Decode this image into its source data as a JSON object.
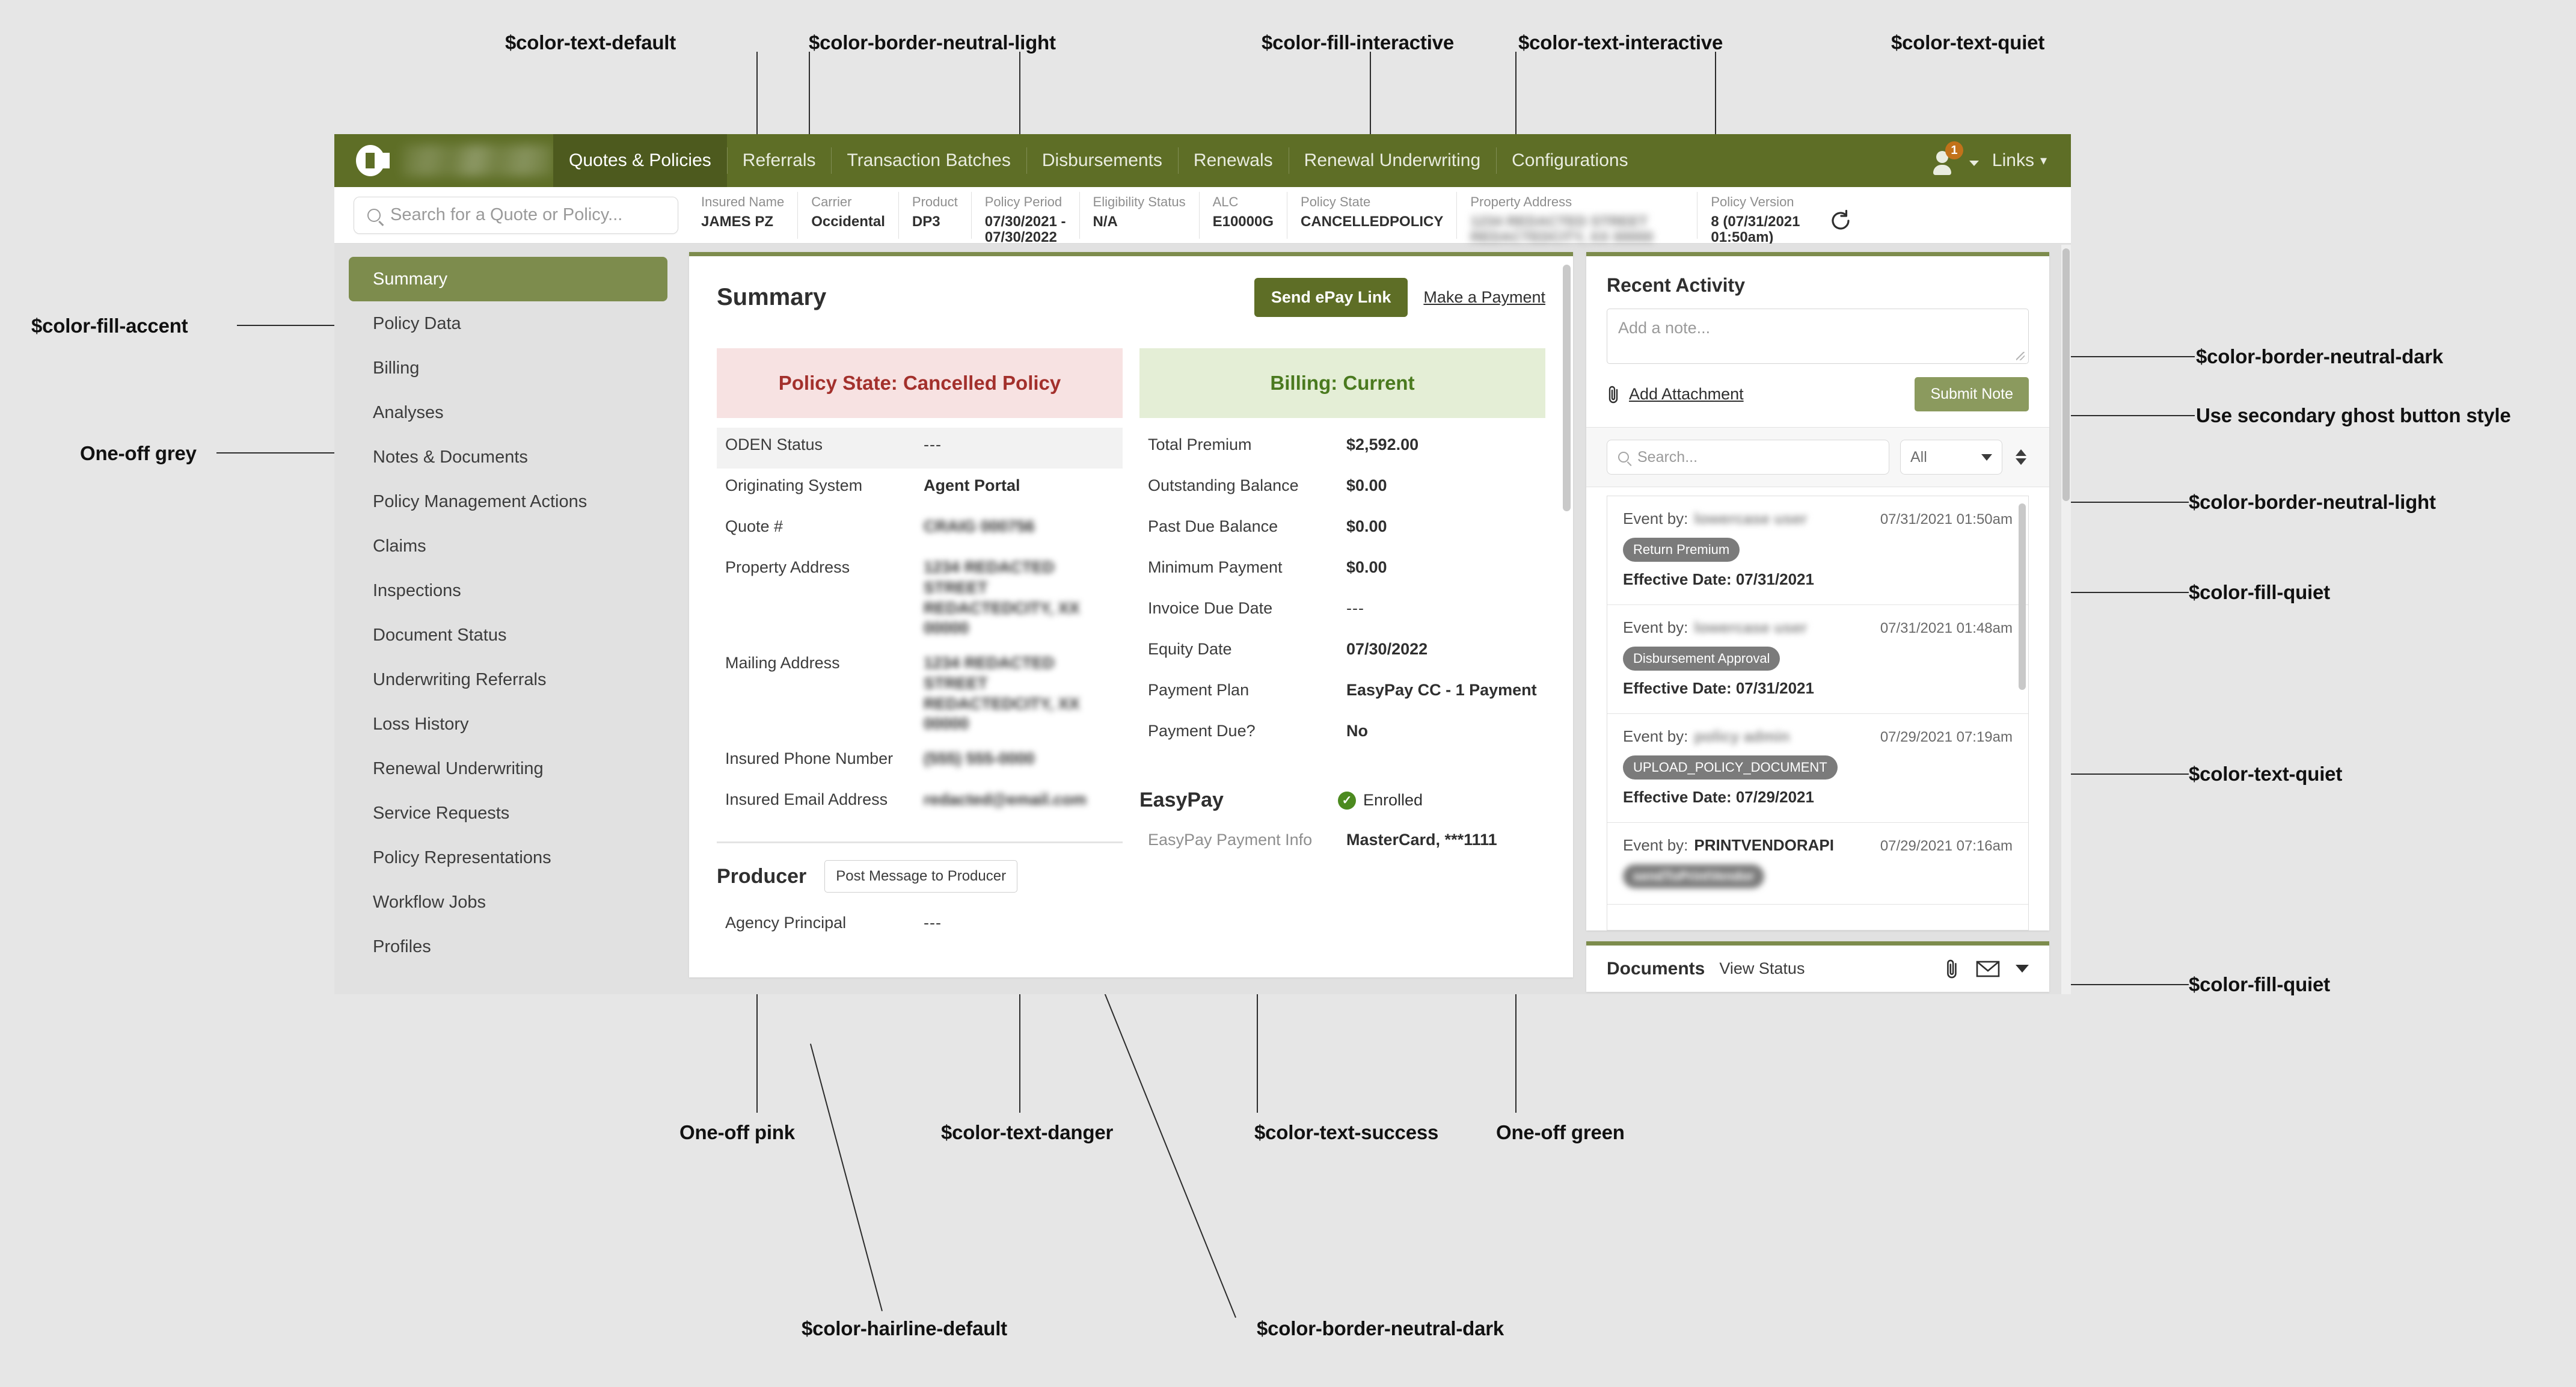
{
  "nav": {
    "logo_name": "company-logo",
    "items": [
      {
        "label": "Quotes & Policies",
        "active": true
      },
      {
        "label": "Referrals",
        "active": false
      },
      {
        "label": "Transaction Batches",
        "active": false
      },
      {
        "label": "Disbursements",
        "active": false
      },
      {
        "label": "Renewals",
        "active": false
      },
      {
        "label": "Renewal Underwriting",
        "active": false
      },
      {
        "label": "Configurations",
        "active": false
      }
    ],
    "user_badge_count": "1",
    "links_label": "Links",
    "caret": "▾"
  },
  "search": {
    "placeholder": "Search for a Quote or Policy..."
  },
  "policy_header": {
    "fields": [
      {
        "label": "Insured Name",
        "value": "JAMES PZ",
        "redacted": false
      },
      {
        "label": "Carrier",
        "value": "Occidental",
        "redacted": false
      },
      {
        "label": "Product",
        "value": "DP3",
        "redacted": false
      },
      {
        "label": "Policy Period",
        "value": "07/30/2021 -\n07/30/2022",
        "redacted": false
      },
      {
        "label": "Eligibility Status",
        "value": "N/A",
        "redacted": false
      },
      {
        "label": "ALC",
        "value": "E10000G",
        "redacted": false
      },
      {
        "label": "Policy State",
        "value": "CANCELLEDPOLICY",
        "redacted": false
      },
      {
        "label": "Property Address",
        "value": "1234 REDACTED STREET\nREDACTEDCITY, XX 00000",
        "redacted": true
      },
      {
        "label": "Policy Version",
        "value": "8 (07/31/2021\n01:50am)",
        "redacted": false
      }
    ],
    "refresh_icon": "refresh-icon"
  },
  "sidebar": {
    "items": [
      {
        "label": "Summary",
        "active": true
      },
      {
        "label": "Policy Data",
        "active": false
      },
      {
        "label": "Billing",
        "active": false
      },
      {
        "label": "Analyses",
        "active": false
      },
      {
        "label": "Notes & Documents",
        "active": false
      },
      {
        "label": "Policy Management Actions",
        "active": false
      },
      {
        "label": "Claims",
        "active": false
      },
      {
        "label": "Inspections",
        "active": false
      },
      {
        "label": "Document Status",
        "active": false
      },
      {
        "label": "Underwriting Referrals",
        "active": false
      },
      {
        "label": "Loss History",
        "active": false
      },
      {
        "label": "Renewal Underwriting",
        "active": false
      },
      {
        "label": "Service Requests",
        "active": false
      },
      {
        "label": "Policy Representations",
        "active": false
      },
      {
        "label": "Workflow Jobs",
        "active": false
      },
      {
        "label": "Profiles",
        "active": false
      }
    ]
  },
  "summary": {
    "title": "Summary",
    "send_epay_label": "Send ePay Link",
    "make_payment_label": "Make a Payment",
    "left": {
      "banner": "Policy State: Cancelled Policy",
      "rows": [
        {
          "key": "ODEN Status",
          "value": "---",
          "quiet": true,
          "redacted": false,
          "dashes": true
        },
        {
          "key": "Originating System",
          "value": "Agent Portal",
          "quiet": false,
          "redacted": false
        },
        {
          "key": "Quote #",
          "value": "CRAIG 000756",
          "quiet": false,
          "redacted": true
        },
        {
          "key": "Property Address",
          "value": "1234 REDACTED STREET\nREDACTEDCITY, XX 00000",
          "quiet": false,
          "redacted": true
        },
        {
          "key": "Mailing Address",
          "value": "1234 REDACTED STREET\nREDACTEDCITY, XX 00000",
          "quiet": false,
          "redacted": true
        },
        {
          "key": "Insured Phone Number",
          "value": "(555) 555-0000",
          "quiet": false,
          "redacted": true
        },
        {
          "key": "Insured Email Address",
          "value": "redacted@email.com",
          "quiet": false,
          "redacted": true
        }
      ],
      "producer_title": "Producer",
      "post_message_label": "Post Message to Producer",
      "producer_rows": [
        {
          "key": "Agency Principal",
          "value": "---",
          "dashes": true
        }
      ]
    },
    "right": {
      "banner": "Billing: Current",
      "rows": [
        {
          "key": "Total Premium",
          "value": "$2,592.00"
        },
        {
          "key": "Outstanding Balance",
          "value": "$0.00"
        },
        {
          "key": "Past Due Balance",
          "value": "$0.00"
        },
        {
          "key": "Minimum Payment",
          "value": "$0.00"
        },
        {
          "key": "Invoice Due Date",
          "value": "---",
          "dashes": true
        },
        {
          "key": "Equity Date",
          "value": "07/30/2022"
        },
        {
          "key": "Payment Plan",
          "value": "EasyPay CC - 1 Payment"
        },
        {
          "key": "Payment Due?",
          "value": "No"
        }
      ],
      "easypay_title": "EasyPay",
      "easypay_status": "Enrolled",
      "easypay_check": "✓",
      "easypay_rows": [
        {
          "key": "EasyPay Payment Info",
          "value": "MasterCard, ***1111"
        }
      ]
    }
  },
  "activity": {
    "title": "Recent Activity",
    "note_placeholder": "Add a note...",
    "add_attachment_label": "Add Attachment",
    "submit_note_label": "Submit Note",
    "search_placeholder": "Search...",
    "filter_value": "All",
    "events": [
      {
        "by_label": "Event by:",
        "by_value": "lowercase user",
        "by_redacted": true,
        "time": "07/31/2021 01:50am",
        "pill": "Return Premium",
        "effective": "Effective Date: 07/31/2021"
      },
      {
        "by_label": "Event by:",
        "by_value": "lowercase user",
        "by_redacted": true,
        "time": "07/31/2021 01:48am",
        "pill": "Disbursement Approval",
        "effective": "Effective Date: 07/31/2021"
      },
      {
        "by_label": "Event by:",
        "by_value": "policy admin",
        "by_redacted": true,
        "time": "07/29/2021 07:19am",
        "pill": "UPLOAD_POLICY_DOCUMENT",
        "effective": "Effective Date: 07/29/2021"
      },
      {
        "by_label": "Event by:",
        "by_value": "PRINTVENDORAPI",
        "by_redacted": false,
        "time": "07/29/2021 07:16am",
        "pill": "sendToPrintVendor",
        "effective": ""
      }
    ]
  },
  "documents": {
    "title": "Documents",
    "view_status_label": "View Status",
    "attachment_icon": "paperclip-icon",
    "mail_icon": "envelope-icon",
    "chevron_icon": "chevron-down-icon"
  },
  "annotations": {
    "top": [
      {
        "text": "$color-text-default"
      },
      {
        "text": "$color-border-neutral-light"
      },
      {
        "text": "$color-fill-interactive"
      },
      {
        "text": "$color-text-interactive"
      },
      {
        "text": "$color-text-quiet"
      }
    ],
    "left": [
      {
        "text": "$color-fill-accent"
      },
      {
        "text": "One-off grey"
      }
    ],
    "right": [
      {
        "text": "$color-border-neutral-dark"
      },
      {
        "text": "Use secondary ghost button style"
      },
      {
        "text": "$color-border-neutral-light"
      },
      {
        "text": "$color-fill-quiet"
      },
      {
        "text": "$color-text-quiet"
      },
      {
        "text": "$color-fill-quiet"
      }
    ],
    "bottom": [
      {
        "text": "One-off pink"
      },
      {
        "text": "$color-text-danger"
      },
      {
        "text": "$color-text-success"
      },
      {
        "text": "One-off green"
      },
      {
        "text": "$color-hairline-default"
      },
      {
        "text": "$color-border-neutral-dark"
      }
    ]
  },
  "colors": {
    "accent_green": "#7d8c4d",
    "nav_green": "#5e6e26",
    "danger_text": "#a3302c",
    "danger_bg": "#f7e2e2",
    "success_text": "#4a7a1f",
    "success_bg": "#e4eed6",
    "badge_orange": "#c2721a",
    "page_bg": "#e6e6e6"
  }
}
